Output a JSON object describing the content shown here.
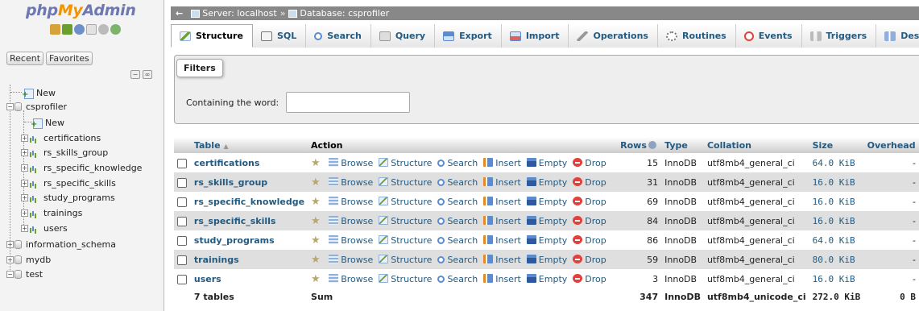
{
  "nav": {
    "logo_php": "php",
    "logo_my": "My",
    "logo_admin": "Admin",
    "recent_label": "Recent",
    "favorites_label": "Favorites",
    "new_label": "New",
    "db_name": "csprofiler",
    "db_new_label": "New",
    "tables": [
      "certifications",
      "rs_skills_group",
      "rs_specific_knowledge",
      "rs_specific_skills",
      "study_programs",
      "trainings",
      "users"
    ],
    "other_dbs": [
      "information_schema",
      "mydb",
      "test"
    ]
  },
  "breadcrumb": {
    "server_label": "Server: localhost",
    "separator": "»",
    "database_label": "Database: csprofiler"
  },
  "tabs": [
    {
      "label": "Structure",
      "icon": "structure-icon",
      "active": true
    },
    {
      "label": "SQL",
      "icon": "sql-icon"
    },
    {
      "label": "Search",
      "icon": "search-icon"
    },
    {
      "label": "Query",
      "icon": "query-icon"
    },
    {
      "label": "Export",
      "icon": "export-icon"
    },
    {
      "label": "Import",
      "icon": "import-icon"
    },
    {
      "label": "Operations",
      "icon": "wrench-icon"
    },
    {
      "label": "Routines",
      "icon": "routines-icon"
    },
    {
      "label": "Events",
      "icon": "clock-icon"
    },
    {
      "label": "Triggers",
      "icon": "triggers-icon"
    },
    {
      "label": "Designer",
      "icon": "designer-icon"
    }
  ],
  "filters": {
    "legend": "Filters",
    "label": "Containing the word:",
    "value": ""
  },
  "table": {
    "headers": {
      "table": "Table",
      "action": "Action",
      "rows": "Rows",
      "type": "Type",
      "collation": "Collation",
      "size": "Size",
      "overhead": "Overhead"
    },
    "actions": [
      "Browse",
      "Structure",
      "Search",
      "Insert",
      "Empty",
      "Drop"
    ],
    "rows": [
      {
        "name": "certifications",
        "rows": "15",
        "type": "InnoDB",
        "collation": "utf8mb4_general_ci",
        "size": "64.0 KiB",
        "overhead": "-"
      },
      {
        "name": "rs_skills_group",
        "rows": "31",
        "type": "InnoDB",
        "collation": "utf8mb4_general_ci",
        "size": "16.0 KiB",
        "overhead": "-"
      },
      {
        "name": "rs_specific_knowledge",
        "rows": "69",
        "type": "InnoDB",
        "collation": "utf8mb4_general_ci",
        "size": "16.0 KiB",
        "overhead": "-"
      },
      {
        "name": "rs_specific_skills",
        "rows": "84",
        "type": "InnoDB",
        "collation": "utf8mb4_general_ci",
        "size": "16.0 KiB",
        "overhead": "-"
      },
      {
        "name": "study_programs",
        "rows": "86",
        "type": "InnoDB",
        "collation": "utf8mb4_general_ci",
        "size": "64.0 KiB",
        "overhead": "-"
      },
      {
        "name": "trainings",
        "rows": "59",
        "type": "InnoDB",
        "collation": "utf8mb4_general_ci",
        "size": "80.0 KiB",
        "overhead": "-"
      },
      {
        "name": "users",
        "rows": "3",
        "type": "InnoDB",
        "collation": "utf8mb4_general_ci",
        "size": "16.0 KiB",
        "overhead": "-"
      }
    ],
    "footer": {
      "count": "7 tables",
      "sum": "Sum",
      "rows": "347",
      "type": "InnoDB",
      "collation": "utf8mb4_unicode_ci",
      "size": "272.0 KiB",
      "overhead": "0 B"
    }
  },
  "colors": {
    "link": "#235a81",
    "logo_blue": "#6c78af",
    "logo_orange": "#f29400",
    "drop_red": "#e0413c"
  }
}
